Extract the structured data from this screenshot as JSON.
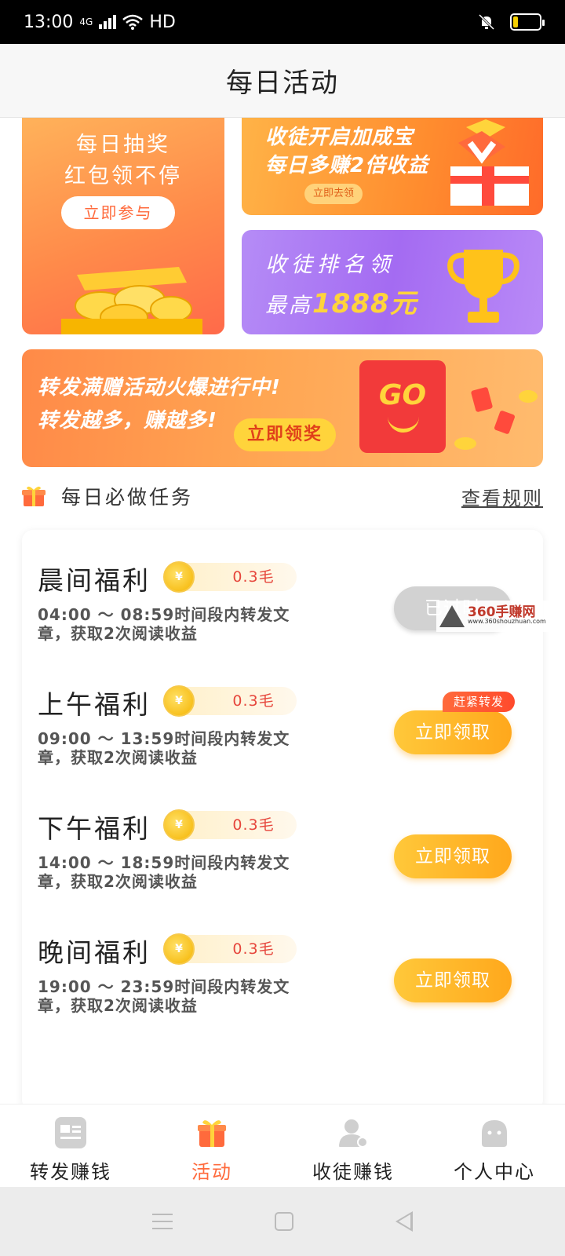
{
  "status_bar": {
    "time": "13:00",
    "network": "4G",
    "hd": "HD"
  },
  "header": {
    "title": "每日活动"
  },
  "banners": {
    "lottery": {
      "line1": "每日抽奖",
      "line2": "红包领不停",
      "button": "立即参与"
    },
    "bonus": {
      "line1": "收徒开启加成宝",
      "line2": "每日多赚2倍收益",
      "button": "立即去领"
    },
    "rank": {
      "line1": "收徒排名领",
      "prefix": "最高",
      "amount": "1888元"
    },
    "share": {
      "line1": "转发满赠活动火爆进行中!",
      "line2": "转发越多，赚越多!",
      "button": "立即领奖",
      "badge": "GO"
    }
  },
  "tasks_section": {
    "title": "每日必做任务",
    "rules_link": "查看规则"
  },
  "tasks": [
    {
      "name": "晨间福利",
      "reward": "0.3毛",
      "desc": "04:00 ～ 08:59时间段内转发文章，获取2次阅读收益",
      "button": "已过时",
      "state": "expired"
    },
    {
      "name": "上午福利",
      "reward": "0.3毛",
      "desc": "09:00 ～ 13:59时间段内转发文章，获取2次阅读收益",
      "button": "立即领取",
      "state": "active",
      "tag": "赶紧转发"
    },
    {
      "name": "下午福利",
      "reward": "0.3毛",
      "desc": "14:00 ～ 18:59时间段内转发文章，获取2次阅读收益",
      "button": "立即领取",
      "state": "active"
    },
    {
      "name": "晚间福利",
      "reward": "0.3毛",
      "desc": "19:00 ～ 23:59时间段内转发文章，获取2次阅读收益",
      "button": "立即领取",
      "state": "active"
    }
  ],
  "coin_symbol": "¥",
  "watermark": {
    "big": "360手赚网",
    "small": "www.360shouzhuan.com"
  },
  "tab_bar": {
    "items": [
      {
        "label": "转发赚钱",
        "icon": "article-icon"
      },
      {
        "label": "活动",
        "icon": "gift-icon"
      },
      {
        "label": "收徒赚钱",
        "icon": "user-add-icon"
      },
      {
        "label": "个人中心",
        "icon": "profile-icon"
      }
    ],
    "active_index": 1
  },
  "colors": {
    "accent": "#ff6a3c",
    "button_gradient": "#ffb12a",
    "reward_text": "#e6463c"
  }
}
